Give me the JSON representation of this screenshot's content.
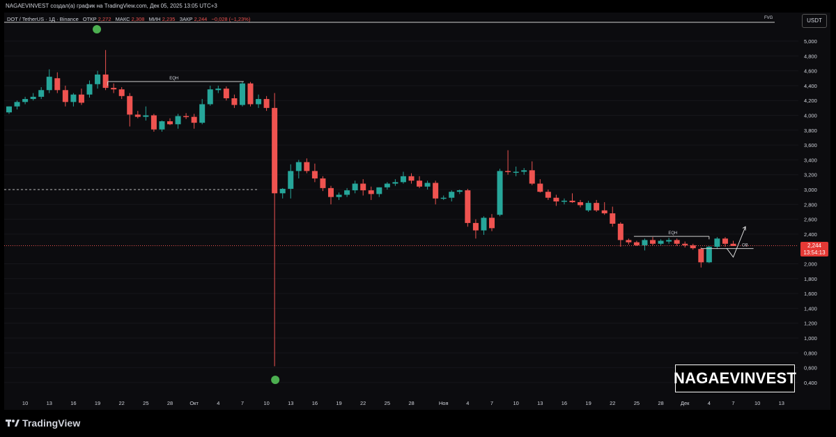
{
  "header": {
    "attribution": "NAGAEVINVEST создал(а) график на TradingView.com, Дек 05, 2025 13:05 UTC+3"
  },
  "symbol_line": {
    "symbol": "DOT / TetherUS · 1Д · Binance",
    "open_label": "ОТКР",
    "open_value": "2,272",
    "high_label": "МАКС",
    "high_value": "2,308",
    "low_label": "МИН",
    "low_value": "2,235",
    "close_label": "ЗАКР",
    "close_value": "2,244",
    "change": "−0,028 (−1,23%)"
  },
  "annotations": {
    "fvg": "FVG",
    "eqh_left": "EQH",
    "eqh_right": "EQH",
    "ob": "OB"
  },
  "price_axis": {
    "currency": "USDT",
    "current_price": "2,244",
    "countdown": "13:54:13",
    "ticks": [
      {
        "v": 5.0,
        "label": "5,000"
      },
      {
        "v": 4.8,
        "label": "4,800"
      },
      {
        "v": 4.6,
        "label": "4,600"
      },
      {
        "v": 4.4,
        "label": "4,400"
      },
      {
        "v": 4.2,
        "label": "4,200"
      },
      {
        "v": 4.0,
        "label": "4,000"
      },
      {
        "v": 3.8,
        "label": "3,800"
      },
      {
        "v": 3.6,
        "label": "3,600"
      },
      {
        "v": 3.4,
        "label": "3,400"
      },
      {
        "v": 3.2,
        "label": "3,200"
      },
      {
        "v": 3.0,
        "label": "3,000"
      },
      {
        "v": 2.8,
        "label": "2,800"
      },
      {
        "v": 2.6,
        "label": "2,600"
      },
      {
        "v": 2.4,
        "label": "2,400"
      },
      {
        "v": 2.0,
        "label": "2,000"
      },
      {
        "v": 1.8,
        "label": "1,800"
      },
      {
        "v": 1.6,
        "label": "1,600"
      },
      {
        "v": 1.4,
        "label": "1,400"
      },
      {
        "v": 1.2,
        "label": "1,200"
      },
      {
        "v": 1.0,
        "label": "1,000"
      },
      {
        "v": 0.8,
        "label": "0,800"
      },
      {
        "v": 0.6,
        "label": "0,600"
      },
      {
        "v": 0.4,
        "label": "0,400"
      }
    ]
  },
  "time_axis": {
    "labels": [
      {
        "i": 2,
        "label": "10"
      },
      {
        "i": 5,
        "label": "13"
      },
      {
        "i": 8,
        "label": "16"
      },
      {
        "i": 11,
        "label": "19"
      },
      {
        "i": 14,
        "label": "22"
      },
      {
        "i": 17,
        "label": "25"
      },
      {
        "i": 20,
        "label": "28"
      },
      {
        "i": 23,
        "label": "Окт"
      },
      {
        "i": 26,
        "label": "4"
      },
      {
        "i": 29,
        "label": "7"
      },
      {
        "i": 32,
        "label": "10"
      },
      {
        "i": 35,
        "label": "13"
      },
      {
        "i": 38,
        "label": "16"
      },
      {
        "i": 41,
        "label": "19"
      },
      {
        "i": 44,
        "label": "22"
      },
      {
        "i": 47,
        "label": "25"
      },
      {
        "i": 50,
        "label": "28"
      },
      {
        "i": 54,
        "label": "Ноя"
      },
      {
        "i": 57,
        "label": "4"
      },
      {
        "i": 60,
        "label": "7"
      },
      {
        "i": 63,
        "label": "10"
      },
      {
        "i": 66,
        "label": "13"
      },
      {
        "i": 69,
        "label": "16"
      },
      {
        "i": 72,
        "label": "19"
      },
      {
        "i": 75,
        "label": "22"
      },
      {
        "i": 78,
        "label": "25"
      },
      {
        "i": 81,
        "label": "28"
      },
      {
        "i": 84,
        "label": "Дек"
      },
      {
        "i": 87,
        "label": "4"
      },
      {
        "i": 90,
        "label": "7"
      },
      {
        "i": 93,
        "label": "10"
      },
      {
        "i": 96,
        "label": "13"
      }
    ]
  },
  "watermark": "NAGAEVINVEST",
  "footer": {
    "brand": "TradingView"
  },
  "colors": {
    "up": "#26a69a",
    "down": "#ef5350",
    "background": "#0c0c0f",
    "text": "#d1d4dc",
    "signal_dot": "#4caf50"
  },
  "chart_data": {
    "type": "candlestick",
    "ylim": [
      0.3,
      5.1
    ],
    "candles": [
      {
        "o": 4.04,
        "h": 4.12,
        "l": 4.02,
        "c": 4.12
      },
      {
        "o": 4.12,
        "h": 4.2,
        "l": 4.08,
        "c": 4.18
      },
      {
        "o": 4.18,
        "h": 4.25,
        "l": 4.15,
        "c": 4.22
      },
      {
        "o": 4.22,
        "h": 4.3,
        "l": 4.2,
        "c": 4.25
      },
      {
        "o": 4.25,
        "h": 4.38,
        "l": 4.22,
        "c": 4.34
      },
      {
        "o": 4.34,
        "h": 4.62,
        "l": 4.3,
        "c": 4.52
      },
      {
        "o": 4.5,
        "h": 4.58,
        "l": 4.3,
        "c": 4.34
      },
      {
        "o": 4.34,
        "h": 4.4,
        "l": 4.12,
        "c": 4.18
      },
      {
        "o": 4.18,
        "h": 4.3,
        "l": 4.12,
        "c": 4.28
      },
      {
        "o": 4.28,
        "h": 4.36,
        "l": 4.14,
        "c": 4.17
      },
      {
        "o": 4.28,
        "h": 4.47,
        "l": 4.24,
        "c": 4.42
      },
      {
        "o": 4.42,
        "h": 4.6,
        "l": 4.36,
        "c": 4.55
      },
      {
        "o": 4.55,
        "h": 4.88,
        "l": 4.34,
        "c": 4.37
      },
      {
        "o": 4.37,
        "h": 4.43,
        "l": 4.3,
        "c": 4.35
      },
      {
        "o": 4.35,
        "h": 4.38,
        "l": 4.22,
        "c": 4.26
      },
      {
        "o": 4.26,
        "h": 4.3,
        "l": 3.85,
        "c": 4.01
      },
      {
        "o": 4.01,
        "h": 4.06,
        "l": 3.96,
        "c": 3.98
      },
      {
        "o": 3.98,
        "h": 4.12,
        "l": 3.93,
        "c": 4.0
      },
      {
        "o": 4.0,
        "h": 4.02,
        "l": 3.78,
        "c": 3.81
      },
      {
        "o": 3.81,
        "h": 3.93,
        "l": 3.78,
        "c": 3.92
      },
      {
        "o": 3.92,
        "h": 3.96,
        "l": 3.87,
        "c": 3.88
      },
      {
        "o": 3.88,
        "h": 4.02,
        "l": 3.82,
        "c": 3.99
      },
      {
        "o": 3.99,
        "h": 4.03,
        "l": 3.95,
        "c": 3.98
      },
      {
        "o": 3.98,
        "h": 4.02,
        "l": 3.82,
        "c": 3.9
      },
      {
        "o": 3.9,
        "h": 4.22,
        "l": 3.88,
        "c": 4.15
      },
      {
        "o": 4.15,
        "h": 4.4,
        "l": 4.13,
        "c": 4.35
      },
      {
        "o": 4.34,
        "h": 4.4,
        "l": 4.3,
        "c": 4.36
      },
      {
        "o": 4.36,
        "h": 4.39,
        "l": 4.2,
        "c": 4.23
      },
      {
        "o": 4.23,
        "h": 4.28,
        "l": 4.1,
        "c": 4.14
      },
      {
        "o": 4.14,
        "h": 4.46,
        "l": 4.12,
        "c": 4.43
      },
      {
        "o": 4.43,
        "h": 4.45,
        "l": 4.12,
        "c": 4.15
      },
      {
        "o": 4.15,
        "h": 4.28,
        "l": 4.1,
        "c": 4.22
      },
      {
        "o": 4.22,
        "h": 4.26,
        "l": 4.06,
        "c": 4.1
      },
      {
        "o": 4.1,
        "h": 4.3,
        "l": 0.62,
        "c": 2.95
      },
      {
        "o": 2.95,
        "h": 3.02,
        "l": 2.88,
        "c": 3.01
      },
      {
        "o": 3.01,
        "h": 3.34,
        "l": 2.88,
        "c": 3.25
      },
      {
        "o": 3.25,
        "h": 3.4,
        "l": 3.15,
        "c": 3.37
      },
      {
        "o": 3.37,
        "h": 3.42,
        "l": 3.22,
        "c": 3.25
      },
      {
        "o": 3.25,
        "h": 3.35,
        "l": 3.1,
        "c": 3.15
      },
      {
        "o": 3.15,
        "h": 3.18,
        "l": 2.98,
        "c": 3.02
      },
      {
        "o": 3.02,
        "h": 3.05,
        "l": 2.8,
        "c": 2.9
      },
      {
        "o": 2.9,
        "h": 2.96,
        "l": 2.86,
        "c": 2.93
      },
      {
        "o": 2.93,
        "h": 3.02,
        "l": 2.9,
        "c": 2.99
      },
      {
        "o": 2.99,
        "h": 3.12,
        "l": 2.95,
        "c": 3.08
      },
      {
        "o": 3.08,
        "h": 3.14,
        "l": 2.92,
        "c": 2.99
      },
      {
        "o": 2.99,
        "h": 3.04,
        "l": 2.86,
        "c": 2.94
      },
      {
        "o": 2.94,
        "h": 3.03,
        "l": 2.9,
        "c": 3.03
      },
      {
        "o": 3.03,
        "h": 3.1,
        "l": 3.0,
        "c": 3.08
      },
      {
        "o": 3.08,
        "h": 3.14,
        "l": 3.05,
        "c": 3.1
      },
      {
        "o": 3.1,
        "h": 3.24,
        "l": 3.08,
        "c": 3.18
      },
      {
        "o": 3.18,
        "h": 3.22,
        "l": 3.08,
        "c": 3.12
      },
      {
        "o": 3.12,
        "h": 3.18,
        "l": 3.02,
        "c": 3.04
      },
      {
        "o": 3.04,
        "h": 3.12,
        "l": 3.0,
        "c": 3.09
      },
      {
        "o": 3.09,
        "h": 3.12,
        "l": 2.8,
        "c": 2.88
      },
      {
        "o": 2.88,
        "h": 2.92,
        "l": 2.86,
        "c": 2.89
      },
      {
        "o": 2.89,
        "h": 2.99,
        "l": 2.84,
        "c": 2.97
      },
      {
        "o": 2.97,
        "h": 3.0,
        "l": 2.94,
        "c": 2.99
      },
      {
        "o": 2.99,
        "h": 3.01,
        "l": 2.5,
        "c": 2.55
      },
      {
        "o": 2.55,
        "h": 2.6,
        "l": 2.34,
        "c": 2.45
      },
      {
        "o": 2.45,
        "h": 2.64,
        "l": 2.39,
        "c": 2.62
      },
      {
        "o": 2.62,
        "h": 2.67,
        "l": 2.44,
        "c": 2.48
      },
      {
        "o": 2.66,
        "h": 3.28,
        "l": 2.64,
        "c": 3.25
      },
      {
        "o": 3.25,
        "h": 3.53,
        "l": 3.2,
        "c": 3.24
      },
      {
        "o": 3.24,
        "h": 3.31,
        "l": 3.18,
        "c": 3.24
      },
      {
        "o": 3.24,
        "h": 3.29,
        "l": 3.2,
        "c": 3.26
      },
      {
        "o": 3.26,
        "h": 3.38,
        "l": 3.06,
        "c": 3.08
      },
      {
        "o": 3.08,
        "h": 3.14,
        "l": 2.96,
        "c": 2.97
      },
      {
        "o": 2.97,
        "h": 3.0,
        "l": 2.86,
        "c": 2.89
      },
      {
        "o": 2.89,
        "h": 2.93,
        "l": 2.78,
        "c": 2.84
      },
      {
        "o": 2.84,
        "h": 2.88,
        "l": 2.8,
        "c": 2.85
      },
      {
        "o": 2.85,
        "h": 2.95,
        "l": 2.82,
        "c": 2.83
      },
      {
        "o": 2.83,
        "h": 2.86,
        "l": 2.76,
        "c": 2.79
      },
      {
        "o": 2.72,
        "h": 2.85,
        "l": 2.7,
        "c": 2.82
      },
      {
        "o": 2.82,
        "h": 2.86,
        "l": 2.7,
        "c": 2.72
      },
      {
        "o": 2.72,
        "h": 2.83,
        "l": 2.66,
        "c": 2.68
      },
      {
        "o": 2.68,
        "h": 2.77,
        "l": 2.5,
        "c": 2.54
      },
      {
        "o": 2.54,
        "h": 2.56,
        "l": 2.23,
        "c": 2.32
      },
      {
        "o": 2.32,
        "h": 2.34,
        "l": 2.26,
        "c": 2.29
      },
      {
        "o": 2.29,
        "h": 2.31,
        "l": 2.24,
        "c": 2.25
      },
      {
        "o": 2.25,
        "h": 2.34,
        "l": 2.18,
        "c": 2.32
      },
      {
        "o": 2.32,
        "h": 2.36,
        "l": 2.25,
        "c": 2.27
      },
      {
        "o": 2.27,
        "h": 2.33,
        "l": 2.25,
        "c": 2.31
      },
      {
        "o": 2.3,
        "h": 2.35,
        "l": 2.27,
        "c": 2.32
      },
      {
        "o": 2.32,
        "h": 2.34,
        "l": 2.24,
        "c": 2.27
      },
      {
        "o": 2.27,
        "h": 2.3,
        "l": 2.22,
        "c": 2.25
      },
      {
        "o": 2.25,
        "h": 2.27,
        "l": 2.19,
        "c": 2.21
      },
      {
        "o": 2.2,
        "h": 2.22,
        "l": 1.95,
        "c": 2.02
      },
      {
        "o": 2.02,
        "h": 2.24,
        "l": 2.01,
        "c": 2.23
      },
      {
        "o": 2.23,
        "h": 2.36,
        "l": 2.2,
        "c": 2.34
      },
      {
        "o": 2.34,
        "h": 2.36,
        "l": 2.23,
        "c": 2.27
      },
      {
        "o": 2.27,
        "h": 2.31,
        "l": 2.24,
        "c": 2.24
      }
    ]
  }
}
